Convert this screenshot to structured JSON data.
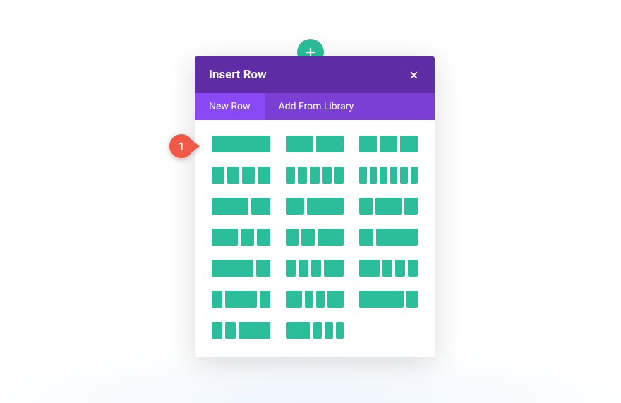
{
  "addButton": {
    "icon": "plus-icon"
  },
  "modal": {
    "title": "Insert Row",
    "close_icon": "close-icon",
    "tabs": [
      {
        "label": "New Row",
        "active": true
      },
      {
        "label": "Add From Library",
        "active": false
      }
    ],
    "badge": {
      "label": "1"
    },
    "layouts": [
      {
        "cols": [
          1
        ]
      },
      {
        "cols": [
          1,
          1
        ]
      },
      {
        "cols": [
          1,
          1,
          1
        ]
      },
      {
        "cols": [
          1,
          1,
          1,
          1
        ]
      },
      {
        "cols": [
          1,
          1,
          1,
          1,
          1
        ]
      },
      {
        "cols": [
          1,
          1,
          1,
          1,
          1,
          1
        ]
      },
      {
        "cols": [
          2,
          1
        ]
      },
      {
        "cols": [
          1,
          2
        ]
      },
      {
        "cols": [
          1,
          2,
          1
        ]
      },
      {
        "cols": [
          2,
          1,
          1
        ]
      },
      {
        "cols": [
          1,
          1,
          2
        ]
      },
      {
        "cols": [
          1,
          3
        ]
      },
      {
        "cols": [
          3,
          1
        ]
      },
      {
        "cols": [
          1,
          1,
          1,
          2
        ]
      },
      {
        "cols": [
          2,
          1,
          1,
          1
        ]
      },
      {
        "cols": [
          1,
          3,
          1
        ]
      },
      {
        "cols": [
          2,
          1,
          1,
          2
        ]
      },
      {
        "cols": [
          4,
          1
        ]
      },
      {
        "cols": [
          1,
          1,
          3
        ]
      },
      {
        "cols": [
          3,
          1,
          1,
          1
        ]
      }
    ]
  }
}
